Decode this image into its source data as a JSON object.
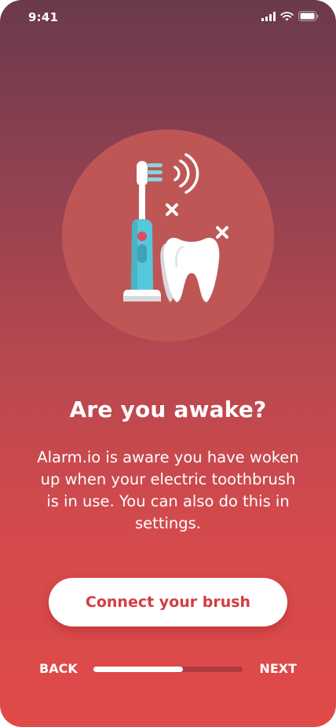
{
  "status_bar": {
    "time": "9:41",
    "icons": [
      "cellular-signal-icon",
      "wifi-icon",
      "battery-icon"
    ]
  },
  "hero": {
    "icons": [
      "electric-toothbrush-icon",
      "vibration-waves-icon",
      "tooth-icon",
      "sparkle-icon"
    ],
    "colors": {
      "circle": "#bf5656",
      "brush_body": "#56c8dc",
      "brush_button": "#e24a60",
      "tooth": "#ffffff"
    }
  },
  "content": {
    "title": "Are you awake?",
    "body": "Alarm.io is aware you have woken up when your electric toothbrush is in use. You can also do this in settings."
  },
  "actions": {
    "connect_label": "Connect your brush"
  },
  "nav": {
    "back_label": "BACK",
    "next_label": "NEXT",
    "progress_fraction": 0.6
  },
  "theme": {
    "gradient_top": "#6a3a4c",
    "gradient_bottom": "#e04a48",
    "accent": "#d43c40"
  }
}
